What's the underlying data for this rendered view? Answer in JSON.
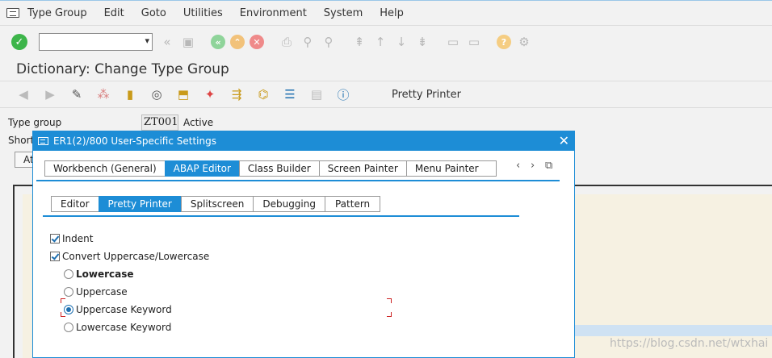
{
  "menu": [
    "Type Group",
    "Edit",
    "Goto",
    "Utilities",
    "Environment",
    "System",
    "Help"
  ],
  "title": "Dictionary: Change Type Group",
  "app_toolbar": {
    "pretty_printer_label": "Pretty Printer"
  },
  "form": {
    "type_group_label": "Type group",
    "type_group_value": "ZT001",
    "status": "Active",
    "short_label": "Short",
    "at_button": "At"
  },
  "dialog": {
    "title": "ER1(2)/800 User-Specific Settings",
    "tabs": [
      "Workbench (General)",
      "ABAP Editor",
      "Class Builder",
      "Screen Painter",
      "Menu Painter"
    ],
    "active_tab": "ABAP Editor",
    "subtabs": [
      "Editor",
      "Pretty Printer",
      "Splitscreen",
      "Debugging",
      "Pattern"
    ],
    "active_subtab": "Pretty Printer",
    "checkboxes": [
      {
        "label": "Indent",
        "checked": true
      },
      {
        "label": "Convert Uppercase/Lowercase",
        "checked": true
      }
    ],
    "radios": [
      {
        "label": "Lowercase",
        "selected": false,
        "bold": true
      },
      {
        "label": "Uppercase",
        "selected": false,
        "bold": false
      },
      {
        "label": "Uppercase Keyword",
        "selected": true,
        "bold": false
      },
      {
        "label": "Lowercase Keyword",
        "selected": false,
        "bold": false
      }
    ]
  },
  "watermark": "https://blog.csdn.net/wtxhai",
  "colors": {
    "accent": "#1d8dd6",
    "ok_green": "#3db54a",
    "editor_bg": "#f6f1e2"
  }
}
